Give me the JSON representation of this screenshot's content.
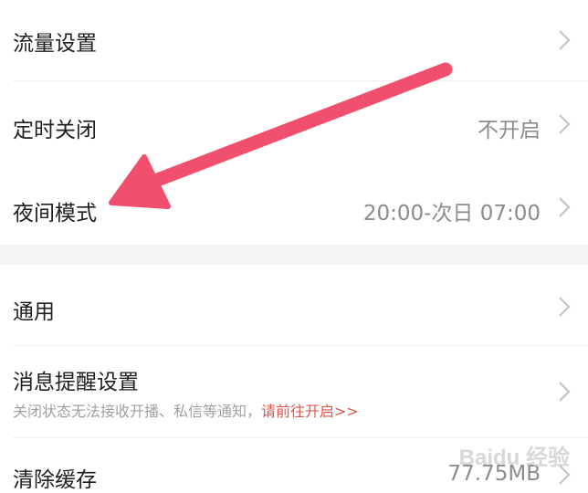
{
  "settings": {
    "group1": [
      {
        "label": "流量设置",
        "value": ""
      },
      {
        "label": "定时关闭",
        "value": "不开启"
      },
      {
        "label": "夜间模式",
        "value": "20:00-次日 07:00"
      }
    ],
    "group2": [
      {
        "label": "通用",
        "value": ""
      },
      {
        "label": "消息提醒设置",
        "value": "",
        "subtitle": "关闭状态无法接收开播、私信等通知，",
        "subtitle_link": "请前往开启>>"
      },
      {
        "label": "清除缓存",
        "value": "77.75MB"
      }
    ]
  },
  "colors": {
    "arrow": "#f0506e",
    "link": "#d9594c",
    "section_gap": "#f4f4f4"
  },
  "icons": {
    "chevron": "chevron-right-icon",
    "annotation": "annotation-arrow-icon"
  },
  "watermark": "Baidu 经验"
}
